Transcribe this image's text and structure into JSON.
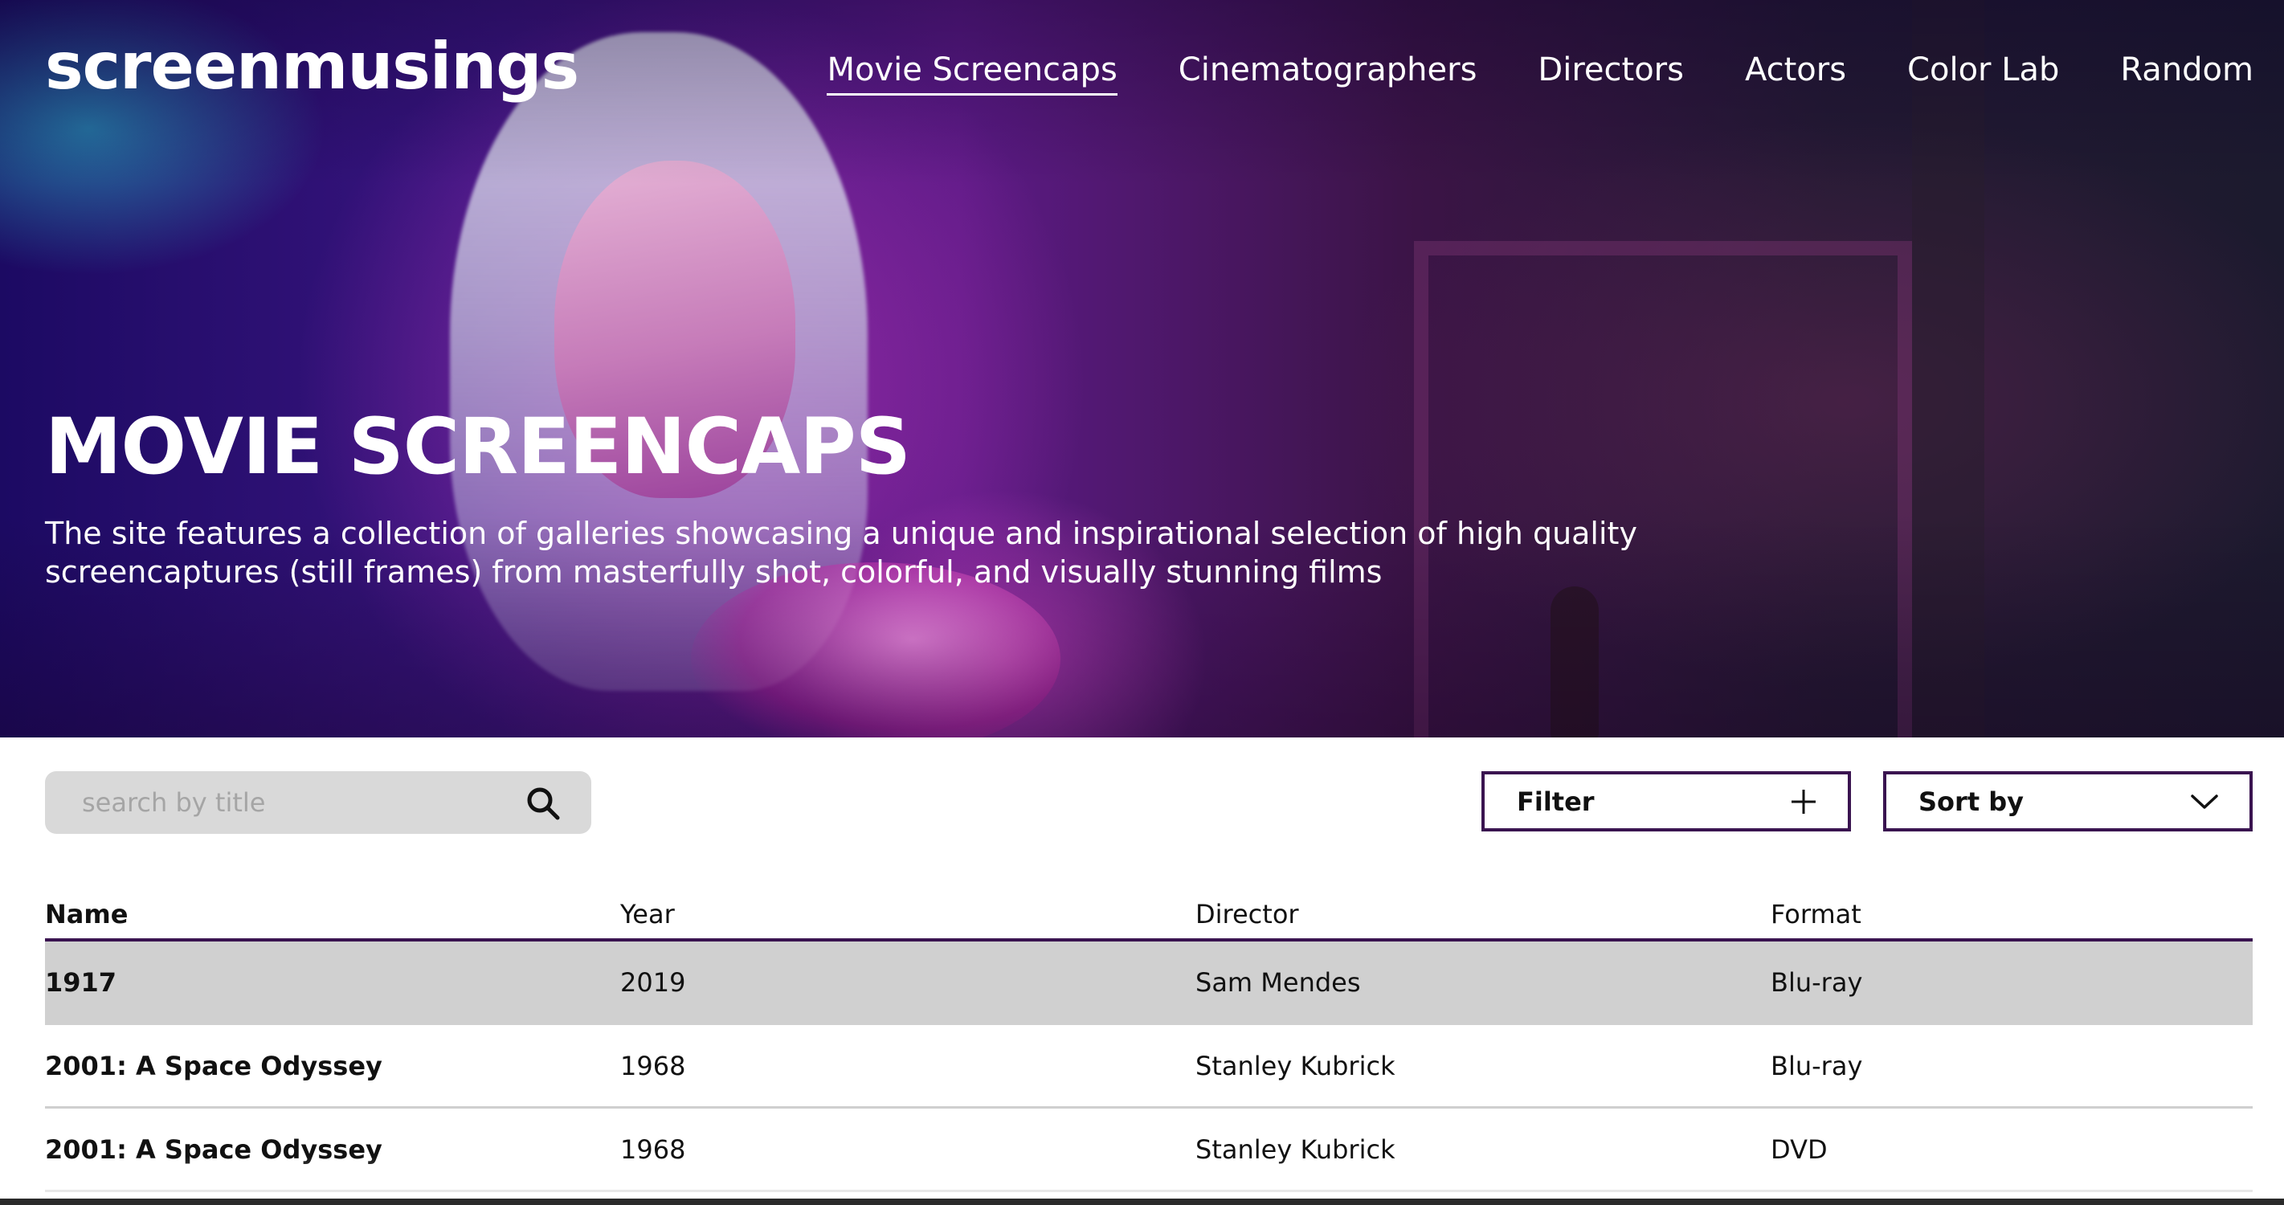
{
  "site": {
    "logo": "screenmusings"
  },
  "nav": {
    "items": [
      {
        "label": "Movie Screencaps",
        "active": true
      },
      {
        "label": "Cinematographers",
        "active": false
      },
      {
        "label": "Directors",
        "active": false
      },
      {
        "label": "Actors",
        "active": false
      },
      {
        "label": "Color Lab",
        "active": false
      },
      {
        "label": "Random",
        "active": false
      }
    ]
  },
  "hero": {
    "title": "MOVIE SCREENCAPS",
    "description": "The site features a collection of galleries showcasing a unique and inspirational selection of high quality screencaptures (still frames) from masterfully shot, colorful, and visually stunning films"
  },
  "search": {
    "placeholder": "search by title",
    "value": "",
    "icon": "search-icon"
  },
  "controls": {
    "filter_label": "Filter",
    "filter_icon": "plus-icon",
    "sort_label": "Sort by",
    "sort_icon": "chevron-down-icon"
  },
  "table": {
    "columns": [
      "Name",
      "Year",
      "Director",
      "Format"
    ],
    "rows": [
      {
        "name": "1917",
        "year": "2019",
        "director": "Sam Mendes",
        "format": "Blu-ray",
        "highlighted": true
      },
      {
        "name": "2001: A Space Odyssey",
        "year": "1968",
        "director": "Stanley Kubrick",
        "format": "Blu-ray",
        "highlighted": false
      },
      {
        "name": "2001: A Space Odyssey",
        "year": "1968",
        "director": "Stanley Kubrick",
        "format": "DVD",
        "highlighted": false
      }
    ]
  },
  "colors": {
    "accent": "#3a1450",
    "row_highlight": "#d0d0d0",
    "search_bg": "#d9d9d9"
  }
}
